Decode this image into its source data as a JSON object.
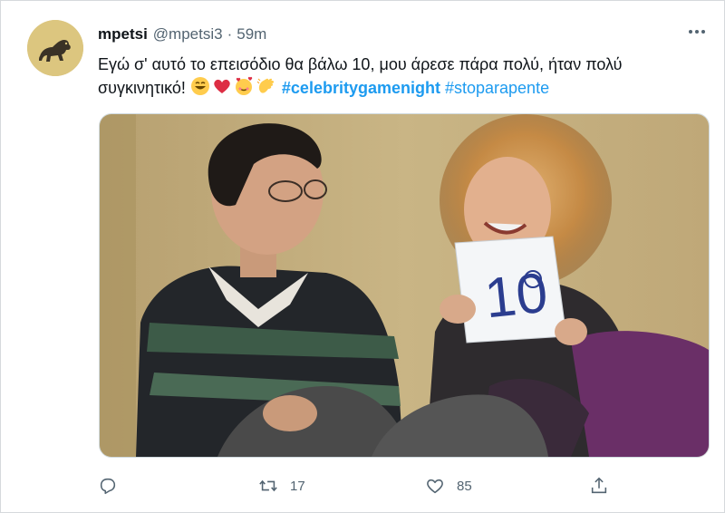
{
  "tweet": {
    "display_name": "mpetsi",
    "handle": "@mpetsi3",
    "separator": "·",
    "time": "59m",
    "text_line1": "Εγώ σ' αυτό το επεισόδιο θα βάλω 10, μου άρεσε πάρα πολύ, ήταν πολύ",
    "text_line2": "συγκινητικό!",
    "emojis": [
      "grinning-face",
      "red-heart",
      "smiling-face-with-hearts",
      "clapping-hands"
    ],
    "hashtags": [
      "#celebritygamenight",
      "#stoparapente"
    ],
    "media": {
      "card_text": "10"
    }
  },
  "actions": {
    "reply": {
      "icon": "reply-icon",
      "count": ""
    },
    "retweet": {
      "icon": "retweet-icon",
      "count": "17"
    },
    "like": {
      "icon": "heart-icon",
      "count": "85"
    },
    "share": {
      "icon": "share-icon",
      "count": ""
    }
  },
  "colors": {
    "link": "#1d9bf0",
    "text": "#0f1419",
    "muted": "#536471"
  }
}
